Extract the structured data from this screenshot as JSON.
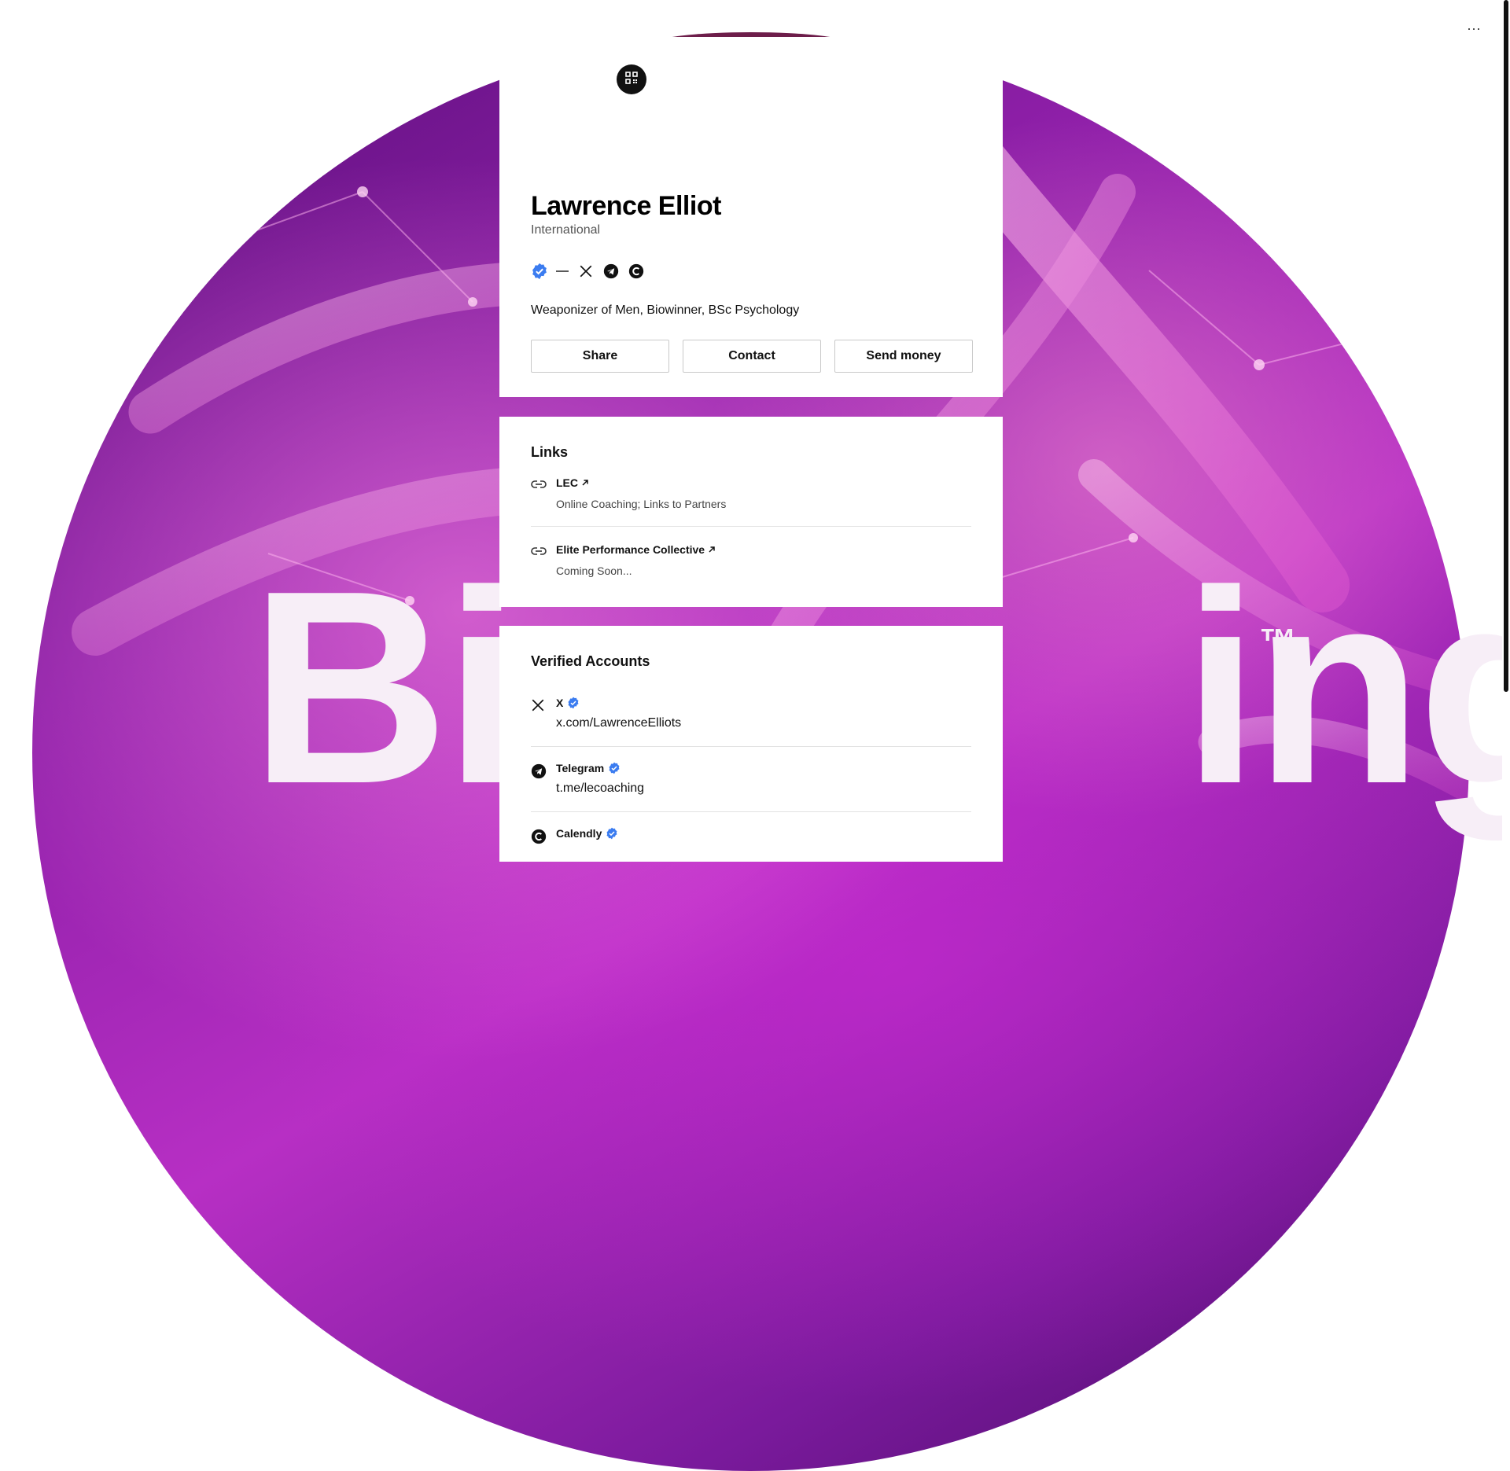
{
  "background": {
    "wordmark": "Bio",
    "wordmark_tail": "ing",
    "trademark": "™",
    "colors": {
      "deep": "#5a0f7a",
      "mid": "#b72fc4",
      "highlight": "#ff8ce6"
    }
  },
  "page": {
    "more_label": "···"
  },
  "profile": {
    "qr_icon": "qr-code-icon",
    "name": "Lawrence Elliot",
    "location": "International",
    "social_icons": [
      "verified-badge-icon",
      "dash-icon",
      "x-icon",
      "telegram-icon",
      "calendly-icon"
    ],
    "bio": "Weaponizer of Men, Biowinner, BSc Psychology",
    "actions": {
      "share": "Share",
      "contact": "Contact",
      "send_money": "Send money"
    }
  },
  "links": {
    "title": "Links",
    "items": [
      {
        "title": "LEC",
        "subtitle": "Online Coaching; Links to Partners",
        "icon": "link-icon"
      },
      {
        "title": "Elite Performance Collective",
        "subtitle": "Coming Soon...",
        "icon": "link-icon"
      }
    ]
  },
  "verified_accounts": {
    "title": "Verified Accounts",
    "items": [
      {
        "platform": "X",
        "handle": "x.com/LawrenceElliots",
        "icon": "x-icon"
      },
      {
        "platform": "Telegram",
        "handle": "t.me/lecoaching",
        "icon": "telegram-icon"
      },
      {
        "platform": "Calendly",
        "handle": "",
        "icon": "calendly-icon"
      }
    ]
  },
  "colors": {
    "verified_blue": "#3b7cf0",
    "text": "#111111",
    "border": "#c9c9c9"
  }
}
